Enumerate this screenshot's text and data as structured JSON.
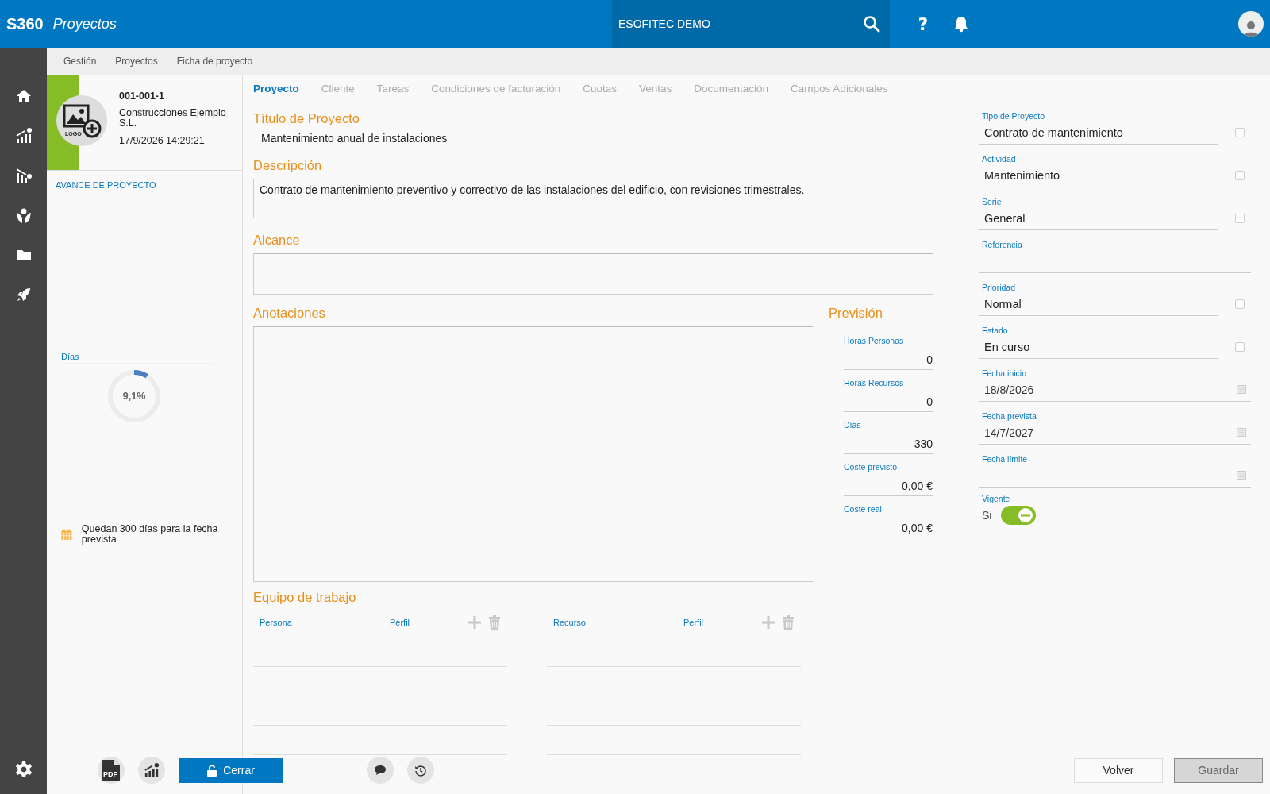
{
  "app": {
    "brand": "S360",
    "module": "Proyectos",
    "company": "ESOFITEC DEMO",
    "help": "?"
  },
  "breadcrumb": [
    "Gestión",
    "Proyectos",
    "Ficha de proyecto"
  ],
  "project_card": {
    "logo_label": "LOGO",
    "code": "001-001-1",
    "client": "Construcciones Ejemplo S.L.",
    "timestamp": "17/9/2026 14:29:21"
  },
  "progress": {
    "title": "AVANCE DE PROYECTO",
    "metric": "Días",
    "level": 0.091,
    "reading": "9,1%",
    "note": "Quedan 300 días para la fecha prevista"
  },
  "tabs": [
    {
      "label": "Proyecto",
      "selected": true
    },
    {
      "label": "Cliente",
      "selected": false
    },
    {
      "label": "Tareas",
      "selected": false
    },
    {
      "label": "Condiciones de facturación",
      "selected": false
    },
    {
      "label": "Cuotas",
      "selected": false
    },
    {
      "label": "Ventas",
      "selected": false
    },
    {
      "label": "Documentación",
      "selected": false
    },
    {
      "label": "Campos Adicionales",
      "selected": false
    }
  ],
  "form": {
    "title": {
      "label": "Título de Proyecto",
      "value": "Mantenimiento anual de instalaciones"
    },
    "description": {
      "label": "Descripción",
      "value": "Contrato de mantenimiento preventivo y correctivo de las instalaciones del edificio, con revisiones trimestrales."
    },
    "scope": {
      "label": "Alcance"
    },
    "notes": {
      "label": "Anotaciones"
    }
  },
  "forecast": {
    "title": "Previsión",
    "fields": [
      {
        "label": "Horas Personas",
        "value": "0"
      },
      {
        "label": "Horas Recursos",
        "value": "0"
      },
      {
        "label": "Días",
        "value": "330"
      },
      {
        "label": "Coste previsto",
        "value": "0,00 €"
      },
      {
        "label": "Coste real",
        "value": "0,00 €"
      }
    ]
  },
  "team": {
    "title": "Equipo de trabajo",
    "tables": [
      {
        "columns": [
          "Persona",
          "Perfil"
        ]
      },
      {
        "columns": [
          "Recurso",
          "Perfil"
        ]
      }
    ]
  },
  "details": [
    {
      "kind": "select",
      "label": "Tipo de Proyecto",
      "value": "Contrato de mantenimiento",
      "checked": false
    },
    {
      "kind": "select",
      "label": "Actividad",
      "value": "Mantenimiento",
      "checked": false
    },
    {
      "kind": "select",
      "label": "Serie",
      "value": "General",
      "checked": false
    },
    {
      "kind": "text",
      "label": "Referencia"
    },
    {
      "kind": "select",
      "label": "Prioridad",
      "value": "Normal",
      "checked": false
    },
    {
      "kind": "select",
      "label": "Estado",
      "value": "En curso",
      "checked": false
    },
    {
      "kind": "date",
      "label": "Fecha inicio",
      "value": "18/8/2026"
    },
    {
      "kind": "date",
      "label": "Fecha prevista",
      "value": "14/7/2027"
    },
    {
      "kind": "date",
      "label": "Fecha límite"
    },
    {
      "kind": "toggle",
      "label": "Vigente",
      "value": "Si",
      "on": true
    }
  ],
  "toolbar": {
    "pdf_label": "PDF",
    "close_button": "Cerrar",
    "back_button": "Volver",
    "save_button": {
      "label": "Guardar",
      "disabled": true
    }
  }
}
